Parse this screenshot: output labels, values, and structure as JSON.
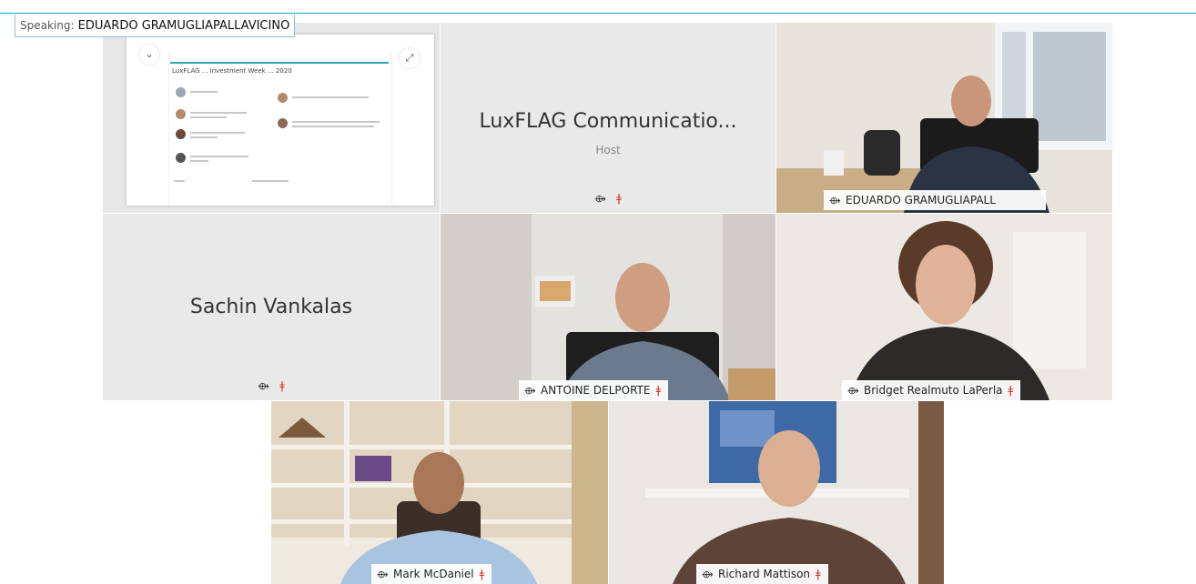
{
  "speaking": {
    "label": "Speaking:",
    "name": "EDUARDO GRAMUGLIAPALLAVICINO"
  },
  "share": {
    "slide_title": "LuxFLAG ... Investment Week ... 2020",
    "back_icon": "chevron-left-icon",
    "expand_icon": "expand-icon"
  },
  "tiles": {
    "host": {
      "name": "LuxFLAG Communicatio...",
      "role": "Host",
      "mic_icon": "microphone-icon",
      "muted_icon": "muted-mic-icon"
    },
    "sachin": {
      "name": "Sachin Vankalas",
      "mic_icon": "microphone-icon",
      "muted_icon": "muted-mic-icon"
    },
    "eduardo": {
      "name": "EDUARDO GRAMUGLIAPALL"
    },
    "antoine": {
      "name": "ANTOINE DELPORTE"
    },
    "bridget": {
      "name": "Bridget Realmuto LaPerla"
    },
    "mark": {
      "name": "Mark McDaniel"
    },
    "richard": {
      "name": "Richard Mattison"
    }
  },
  "colors": {
    "accent": "#2db4e6",
    "muted": "#e0302a",
    "tile_bg": "#e9e9e9"
  }
}
